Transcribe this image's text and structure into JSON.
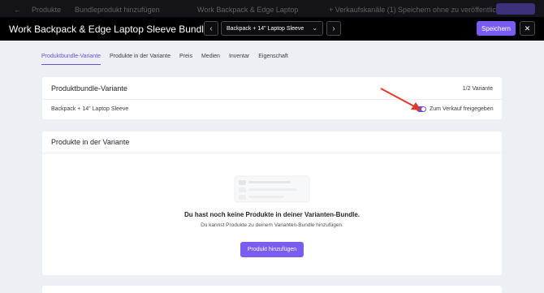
{
  "background_bar": {
    "breadcrumb_products": "Produkte",
    "breadcrumb_add_bundle": "Bundleprodukt hinzufügen",
    "product_name": "Work Backpack & Edge Laptop",
    "sales_channels": "+ Verkaufskanäle (1)",
    "save_unpublished": "Speichern ohne zu veröffentlichen"
  },
  "header": {
    "title": "Work Backpack & Edge Laptop Sleeve Bundle",
    "variant_selected": "Backpack + 14\" Laptop Sleeve",
    "prev_icon": "chevron-left-icon",
    "next_icon": "chevron-right-icon",
    "save_label": "Speichern",
    "close_icon": "close-icon"
  },
  "tabs": [
    {
      "label": "Produktbundle-Variante",
      "active": true
    },
    {
      "label": "Produkte in der Variante",
      "active": false
    },
    {
      "label": "Preis",
      "active": false
    },
    {
      "label": "Medien",
      "active": false
    },
    {
      "label": "Inventar",
      "active": false
    },
    {
      "label": "Eigenschaft",
      "active": false
    }
  ],
  "variant_card": {
    "title": "Produktbundle-Variante",
    "count": "1/2 Variante",
    "variant_name": "Backpack + 14\" Laptop Sleeve",
    "sale_toggle_label": "Zum Verkauf freigegeben",
    "sale_enabled": true
  },
  "products_card": {
    "title": "Produkte in der Variante",
    "empty_title": "Du hast noch keine Produkte in deiner Varianten-Bundle.",
    "empty_subtitle": "Du kannst Produkte zu deinem Varianten-Bundle hinzufügen.",
    "add_button": "Produkt hinzufügen"
  },
  "colors": {
    "accent": "#7a5cf0",
    "header_bg": "#000000",
    "page_bg": "#eceff3",
    "annotation_arrow": "#e0392b"
  }
}
